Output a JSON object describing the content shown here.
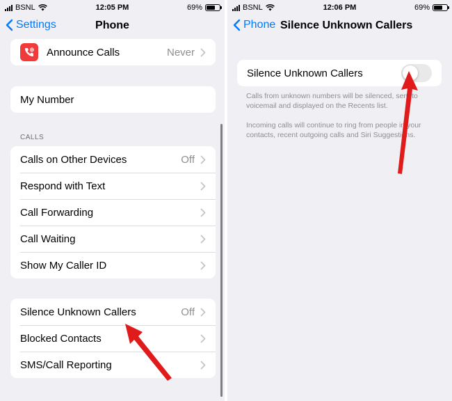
{
  "colors": {
    "accent": "#007aff",
    "arrow": "#e01b1b",
    "icon_bg": "#ef3b3b"
  },
  "left_screen": {
    "status": {
      "carrier": "BSNL",
      "time": "12:05 PM",
      "battery": "69%",
      "battery_level": 0.69
    },
    "nav": {
      "back_label": "Settings",
      "title": "Phone"
    },
    "announce_calls": {
      "label": "Announce Calls",
      "value": "Never",
      "icon": "phone-waveform-icon"
    },
    "my_number": {
      "label": "My Number"
    },
    "calls_header": "CALLS",
    "calls_items": [
      {
        "label": "Calls on Other Devices",
        "value": "Off"
      },
      {
        "label": "Respond with Text",
        "value": ""
      },
      {
        "label": "Call Forwarding",
        "value": ""
      },
      {
        "label": "Call Waiting",
        "value": ""
      },
      {
        "label": "Show My Caller ID",
        "value": ""
      }
    ],
    "blocking_items": [
      {
        "label": "Silence Unknown Callers",
        "value": "Off"
      },
      {
        "label": "Blocked Contacts",
        "value": ""
      },
      {
        "label": "SMS/Call Reporting",
        "value": ""
      }
    ]
  },
  "right_screen": {
    "status": {
      "carrier": "BSNL",
      "time": "12:06 PM",
      "battery": "69%",
      "battery_level": 0.69
    },
    "nav": {
      "back_label": "Phone",
      "title": "Silence Unknown Callers"
    },
    "toggle_row": {
      "label": "Silence Unknown Callers",
      "toggle_on": false
    },
    "footer1": "Calls from unknown numbers will be silenced, sent to voicemail and displayed on the Recents list.",
    "footer2": "Incoming calls will continue to ring from people in your contacts, recent outgoing calls and Siri Suggestions."
  }
}
